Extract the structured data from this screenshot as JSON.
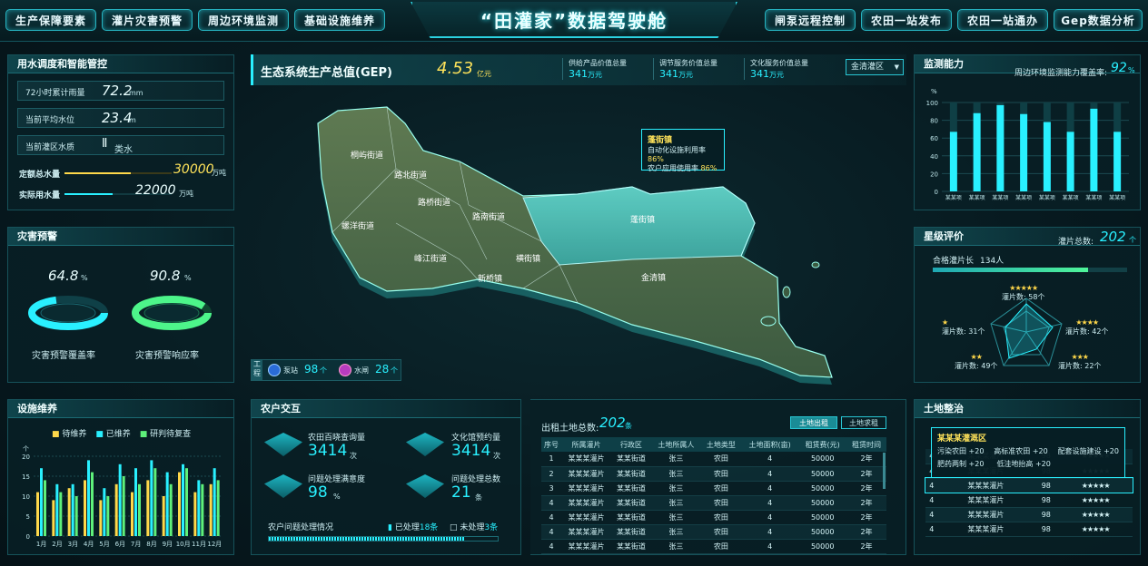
{
  "header": {
    "title": "“田灌家”数据驾驶舱",
    "nav_left": [
      "生产保障要素",
      "灌片灾害预警",
      "周边环境监测",
      "基础设施维养"
    ],
    "nav_right": [
      "闸泵远程控制",
      "农田一站发布",
      "农田一站通办",
      "Gep数据分析"
    ]
  },
  "water": {
    "title": "用水调度和智能管控",
    "rain_label": "72小时累计雨量",
    "rain_value": "72.2",
    "rain_unit": "mm",
    "level_label": "当前平均水位",
    "level_value": "23.4",
    "level_unit": "m",
    "quality_label": "当前灌区水质",
    "quality_value": "Ⅱ",
    "quality_unit": "类水",
    "quota_label": "定额总水量",
    "quota_value": "30000",
    "quota_unit": "万吨",
    "actual_label": "实际用水量",
    "actual_value": "22000",
    "actual_unit": "万吨",
    "quota_fill": 0.62,
    "actual_fill": 0.45
  },
  "disaster": {
    "title": "灾害预警",
    "coverage_value": "64.8",
    "coverage_unit": "%",
    "coverage_label": "灾害预警覆盖率",
    "response_value": "90.8",
    "response_unit": "%",
    "response_label": "灾害预警响应率",
    "coverage_fill": 0.648,
    "response_fill": 0.908
  },
  "maint": {
    "title": "设施维养",
    "legend": [
      "待维养",
      "已维养",
      "研判待复查"
    ],
    "yaxis": [
      "20",
      "15",
      "10",
      "5",
      "0"
    ],
    "ytop": "个",
    "months": [
      "1月",
      "2月",
      "3月",
      "4月",
      "5月",
      "6月",
      "7月",
      "8月",
      "9月",
      "10月",
      "11月",
      "12月"
    ],
    "series": [
      {
        "values": [
          11,
          9,
          12,
          14,
          9,
          13,
          11,
          14,
          10,
          16,
          11,
          13
        ]
      },
      {
        "values": [
          17,
          13,
          13,
          19,
          12,
          18,
          17,
          19,
          16,
          18,
          14,
          17
        ]
      },
      {
        "values": [
          14,
          11,
          10,
          16,
          10,
          15,
          13,
          17,
          13,
          17,
          13,
          14
        ]
      }
    ],
    "colors": [
      "#ffd84a",
      "#29f0ff",
      "#5ef07a"
    ]
  },
  "gep": {
    "title": "生态系统生产总值(GEP)",
    "value": "4.53",
    "unit": "亿元",
    "stats": [
      {
        "label": "供给产品价值总量",
        "value": "341",
        "unit": "万元"
      },
      {
        "label": "调节服务价值总量",
        "value": "341",
        "unit": "万元"
      },
      {
        "label": "文化服务价值总量",
        "value": "341",
        "unit": "万元"
      }
    ],
    "select": "金清灌区"
  },
  "map": {
    "districts": [
      "桐屿街道",
      "路北街道",
      "路桥街道",
      "螺洋街道",
      "路南街道",
      "蓬街镇",
      "峰江街道",
      "横街镇",
      "新桥镇",
      "金清镇"
    ],
    "popup": {
      "name": "蓬街镇",
      "r1_label": "自动化设施利用率",
      "r1_value": "86",
      "r2_label": "农户应用使用率",
      "r2_value": "86",
      "unit": "%"
    },
    "eng_label": "工程",
    "pump_label": "泵站",
    "pump_value": "98",
    "pump_unit": "个",
    "gate_label": "水闸",
    "gate_value": "28",
    "gate_unit": "个"
  },
  "monitor": {
    "title": "监测能力",
    "cover_label": "周边环境监测能力覆盖率:",
    "cover_value": "92",
    "cover_unit": "%",
    "yunit": "%",
    "yaxis": [
      "100",
      "80",
      "60",
      "40",
      "20",
      "0"
    ],
    "bars": [
      67,
      88,
      97,
      87,
      78,
      67,
      93,
      67
    ],
    "xlabel": "某某项"
  },
  "star": {
    "title": "星级评价",
    "total_label": "灌片总数:",
    "total_value": "202",
    "total_unit": "个",
    "qualified_label": "合格灌片长",
    "qualified_value": "134人",
    "qualified_fill": 0.8,
    "items": [
      {
        "stars": "★★★★★",
        "label": "灌片数:",
        "value": "58个"
      },
      {
        "stars": "★★★★",
        "label": "灌片数:",
        "value": "42个"
      },
      {
        "stars": "★★★",
        "label": "灌片数:",
        "value": "22个"
      },
      {
        "stars": "★★",
        "label": "灌片数:",
        "value": "49个"
      },
      {
        "stars": "★",
        "label": "灌片数:",
        "value": "31个"
      }
    ]
  },
  "farmer": {
    "title": "农户交互",
    "items": [
      {
        "label": "农田百晓查询量",
        "value": "3414",
        "unit": "次"
      },
      {
        "label": "文化馆预约量",
        "value": "3414",
        "unit": "次"
      },
      {
        "label": "问题处理满意度",
        "value": "98",
        "unit": "%"
      },
      {
        "label": "问题处理总数",
        "value": "21",
        "unit": "条"
      }
    ],
    "progress_label": "农户问题处理情况",
    "done_label": "已处理",
    "done_value": "18条",
    "todo_label": "未处理",
    "todo_value": "3条",
    "done_fill": 0.857
  },
  "rent": {
    "label": "出租土地总数:",
    "value": "202",
    "unit": "条",
    "tab1": "土地出租",
    "tab2": "土地求租",
    "headers": [
      "序号",
      "所属灌片",
      "行政区",
      "土地所属人",
      "土地类型",
      "土地面积(亩)",
      "租赁费(元)",
      "租赁时间"
    ],
    "rows": [
      [
        "1",
        "某某某灌片",
        "某某街道",
        "张三",
        "农田",
        "4",
        "50000",
        "2年"
      ],
      [
        "2",
        "某某某灌片",
        "某某街道",
        "张三",
        "农田",
        "4",
        "50000",
        "2年"
      ],
      [
        "3",
        "某某某灌片",
        "某某街道",
        "张三",
        "农田",
        "4",
        "50000",
        "2年"
      ],
      [
        "4",
        "某某某灌片",
        "某某街道",
        "张三",
        "农田",
        "4",
        "50000",
        "2年"
      ],
      [
        "4",
        "某某某灌片",
        "某某街道",
        "张三",
        "农田",
        "4",
        "50000",
        "2年"
      ],
      [
        "4",
        "某某某灌片",
        "某某街道",
        "张三",
        "农田",
        "4",
        "50000",
        "2年"
      ],
      [
        "4",
        "某某某灌片",
        "某某街道",
        "张三",
        "农田",
        "4",
        "50000",
        "2年"
      ]
    ]
  },
  "land": {
    "title": "土地整治",
    "popup_title": "某某某灌溉区",
    "popup_items": [
      "污染农田 +20",
      "高标准农田 +20",
      "配套设施建设 +20",
      "肥药两制 +20",
      "低洼地抬高 +20"
    ],
    "rows": [
      [
        "4",
        "某某某灌片",
        "98",
        "★★★★★"
      ],
      [
        "4",
        "某某某灌片",
        "98",
        "★★★★★"
      ],
      [
        "4",
        "某某某灌片",
        "98",
        "★★★★★"
      ],
      [
        "4",
        "某某某灌片",
        "98",
        "★★★★★"
      ],
      [
        "4",
        "某某某灌片",
        "98",
        "★★★★★"
      ],
      [
        "4",
        "某某某灌片",
        "98",
        "★★★★★"
      ]
    ]
  }
}
